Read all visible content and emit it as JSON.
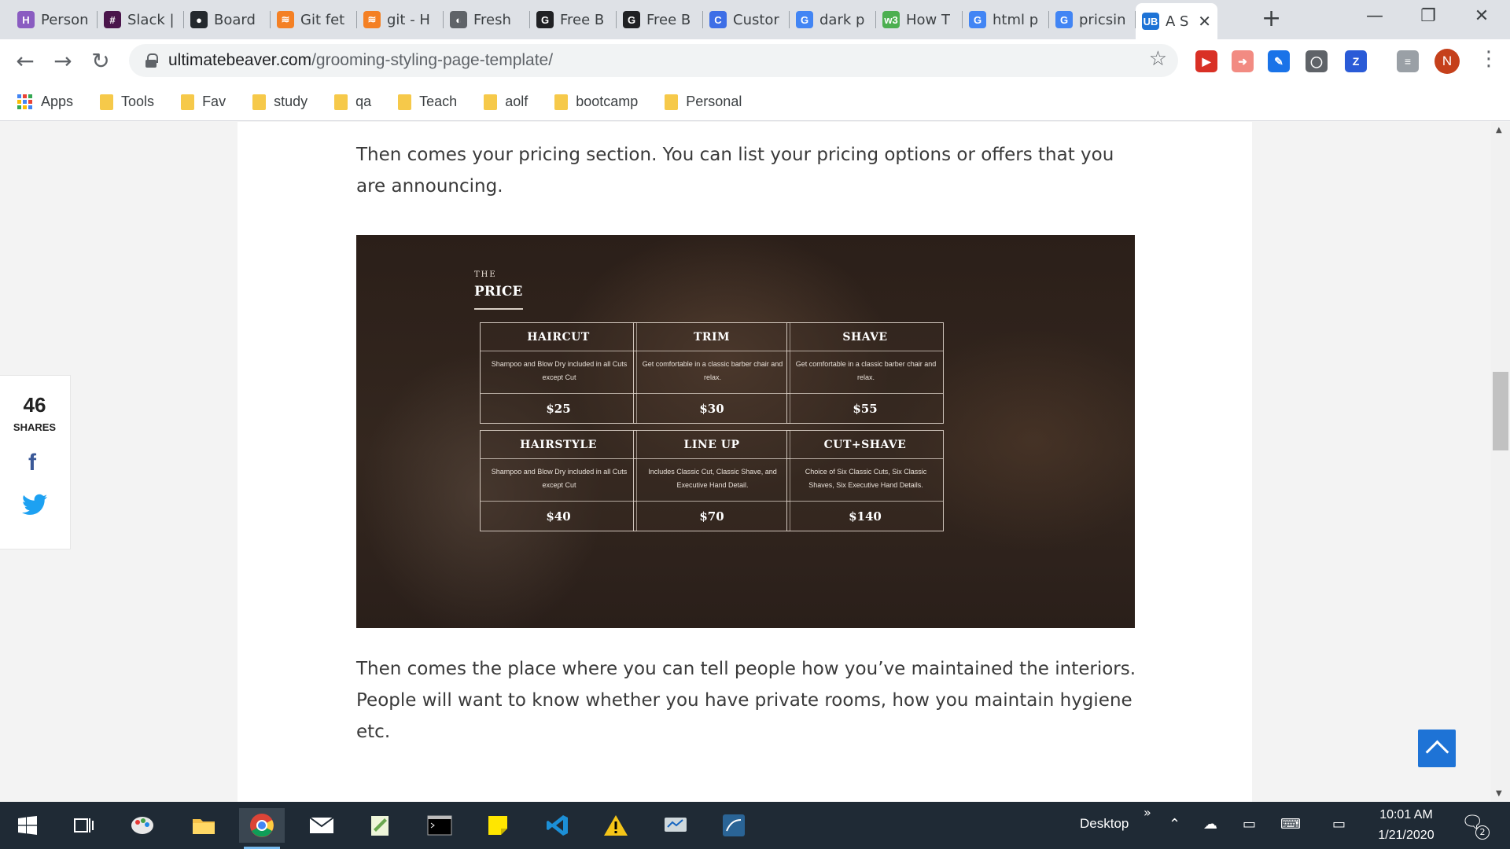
{
  "browser": {
    "tabs": [
      {
        "label": "Person",
        "favicon_text": "H",
        "favicon_color": "#8a5cc1"
      },
      {
        "label": "Slack |",
        "favicon_text": "#",
        "favicon_color": "#4a154b"
      },
      {
        "label": "Board",
        "favicon_text": "●",
        "favicon_color": "#24292e"
      },
      {
        "label": "Git fet",
        "favicon_text": "≋",
        "favicon_color": "#f48024"
      },
      {
        "label": "git - H",
        "favicon_text": "≋",
        "favicon_color": "#f48024"
      },
      {
        "label": "Fresh",
        "favicon_text": "◐",
        "favicon_color": "#5f6368"
      },
      {
        "label": "Free B",
        "favicon_text": "G",
        "favicon_color": "#202124"
      },
      {
        "label": "Free B",
        "favicon_text": "G",
        "favicon_color": "#202124"
      },
      {
        "label": "Custor",
        "favicon_text": "C",
        "favicon_color": "#3d6ee6"
      },
      {
        "label": "dark p",
        "favicon_text": "G",
        "favicon_color": "#4285f4"
      },
      {
        "label": "How T",
        "favicon_text": "w3",
        "favicon_color": "#4caf50"
      },
      {
        "label": "html p",
        "favicon_text": "G",
        "favicon_color": "#4285f4"
      },
      {
        "label": "pricsin",
        "favicon_text": "G",
        "favicon_color": "#4285f4"
      },
      {
        "label": "A S",
        "favicon_text": "UB",
        "favicon_color": "#1e73d6",
        "active": true
      }
    ],
    "new_tab_symbol": "+",
    "window_controls": {
      "minimize": "—",
      "restore": "❐",
      "close": "✕"
    },
    "nav": {
      "back": "←",
      "forward": "→",
      "reload": "↻"
    },
    "url_host": "ultimatebeaver.com",
    "url_path": "/grooming-styling-page-template/",
    "star_symbol": "☆",
    "profile_initial": "N",
    "kebab": "⋮",
    "bookmarks": [
      "Apps",
      "Tools",
      "Fav",
      "study",
      "qa",
      "Teach",
      "aolf",
      "bootcamp",
      "Personal"
    ],
    "extensions": [
      {
        "name": "ext-red-icon",
        "text": "▶",
        "color": "#d93025"
      },
      {
        "name": "ext-arrow-icon",
        "text": "➜",
        "color": "#f28b82"
      },
      {
        "name": "ext-picker-icon",
        "text": "✎",
        "color": "#1a73e8"
      },
      {
        "name": "ext-circle-icon",
        "text": "◯",
        "color": "#5f6368"
      },
      {
        "name": "ext-z-icon",
        "text": "Z",
        "color": "#2a5bd7"
      },
      {
        "name": "ext-list-icon",
        "text": "≡",
        "color": "#9aa0a6"
      }
    ]
  },
  "page": {
    "intro_text": "Then comes your pricing section. You can list your pricing options or offers that you are announcing.",
    "outro_text": "Then comes the place where you can tell people how you’ve maintained the interiors. People will want to know whether you have private rooms, how you maintain hygiene etc.",
    "pricing": {
      "eyebrow": "THE",
      "heading": "PRICE",
      "items": [
        {
          "title": "HAIRCUT",
          "description": "Shampoo and Blow Dry included in all Cuts except Cut",
          "price": "$25"
        },
        {
          "title": "TRIM",
          "description": "Get comfortable in a classic barber chair and relax.",
          "price": "$30"
        },
        {
          "title": "SHAVE",
          "description": "Get comfortable in a classic barber chair and relax.",
          "price": "$55"
        },
        {
          "title": "HAIRSTYLE",
          "description": "Shampoo and Blow Dry included in all Cuts except Cut",
          "price": "$40"
        },
        {
          "title": "LINE UP",
          "description": "Includes Classic Cut, Classic Shave, and Executive Hand Detail.",
          "price": "$70"
        },
        {
          "title": "CUT+SHAVE",
          "description": "Choice of Six Classic Cuts, Six Classic Shaves, Six Executive Hand Details.",
          "price": "$140"
        }
      ]
    },
    "share": {
      "count": "46",
      "label": "SHARES",
      "facebook": "f"
    }
  },
  "taskbar": {
    "desktop_label": "Desktop",
    "chevron": "»",
    "time": "10:01 AM",
    "date": "1/21/2020",
    "notification_count": "2"
  }
}
